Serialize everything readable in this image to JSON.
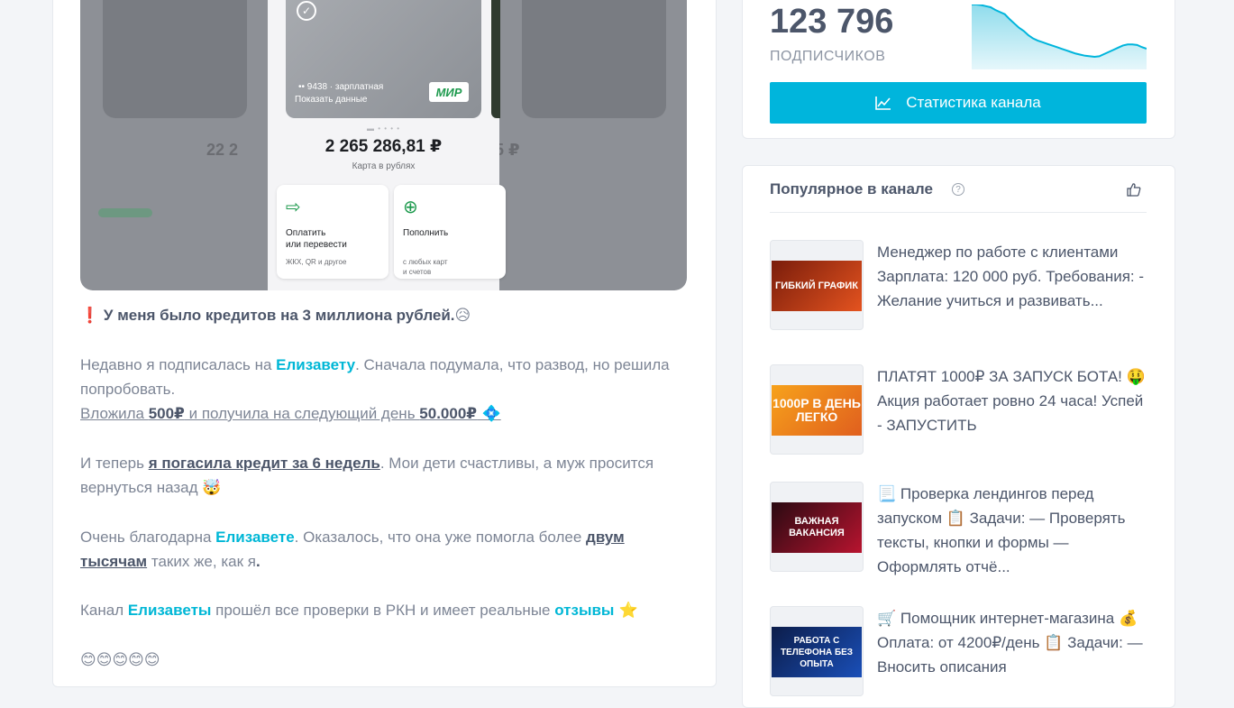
{
  "post": {
    "image": {
      "card_number": "•• 9438 · зарплатная",
      "card_show": "Показать данные",
      "card_brand": "МИР",
      "balance": "2 265 286,81 ₽",
      "balance_sub": "Карта в рублях",
      "action_pay_title": "Оплатить\nили перевести",
      "action_pay_sub": "ЖКХ, QR и другое",
      "action_topup_title": "Пополнить",
      "action_topup_sub": "с любых карт\nи счетов"
    },
    "p1": {
      "emoji": "❗",
      "text": "У меня было кредитов на 3 миллиона рублей.",
      "emoji_end": "😥"
    },
    "p2": {
      "a": "Недавно я подписалась на ",
      "b": "Елизавету",
      "c": ". Сначала подумала, что развод, но решила попробовать.",
      "d": "Вложила ",
      "e": "500₽",
      "f": " и получила на следующий день ",
      "g": "50.000₽",
      "h": " 💠"
    },
    "p3": {
      "a": "И теперь ",
      "b": "я погасила кредит за 6 недель",
      "c": ". Мои дети счастливы, а муж просится вернуться назад ",
      "d": "🤯"
    },
    "p4": {
      "a": "Очень благодарна ",
      "b": "Елизавете",
      "c": ". Оказалось, что она уже помогла более ",
      "d": "двум тысячам",
      "e": " таких же, как я",
      "f": "."
    },
    "p5": {
      "a": "Канал ",
      "b": "Елизаветы",
      "c": " прошёл все проверки в РКН и имеет реальные ",
      "d": "отзывы",
      "e": " ⭐"
    },
    "p6": {
      "emojis": "😊😊😊😊😊"
    }
  },
  "stats": {
    "subscribers": "123 796",
    "subscribers_label": "ПОДПИСЧИКОВ",
    "button_label": "Статистика канала",
    "sparkline": [
      100,
      100,
      99,
      97,
      95,
      90,
      86,
      82,
      73,
      65,
      57,
      51,
      43,
      37,
      33,
      30,
      27,
      24,
      21,
      18,
      15,
      12,
      9,
      7,
      5,
      4,
      3,
      4,
      8,
      12,
      16,
      20,
      24,
      26,
      26,
      25,
      21,
      18
    ],
    "accent_color": "#00b5dc"
  },
  "popular": {
    "title": "Популярное в канале",
    "items": [
      {
        "thumb_text": "ГИБКИЙ ГРАФИК",
        "thumb_color": "#e4531f",
        "text": "Менеджер по работе с клиентами Зарплата: 120 000 руб. Требования: - Желание учиться и развивать..."
      },
      {
        "thumb_text": "1000Р В ДЕНЬ ЛЕГКО",
        "thumb_color": "#f7a21b",
        "text": "ПЛАТЯТ 1000₽ ЗА ЗАПУСК БОТА! 🤑 Акция работает ровно 24 часа! Успей - ЗАПУСТИТЬ"
      },
      {
        "thumb_text": "ВАЖНАЯ ВАКАНСИЯ",
        "thumb_color": "#b8142f",
        "text": "📃 Проверка лендингов перед запуском 📋 Задачи: — Проверять тексты, кнопки и формы — Оформлять отчё..."
      },
      {
        "thumb_text": "РАБОТА С ТЕЛЕФОНА БЕЗ ОПЫТА",
        "thumb_color": "#1a4fb8",
        "text": "🛒 Помощник интернет-магазина 💰 Оплата: от 4200₽/день 📋 Задачи: — Вносить описания"
      }
    ]
  }
}
